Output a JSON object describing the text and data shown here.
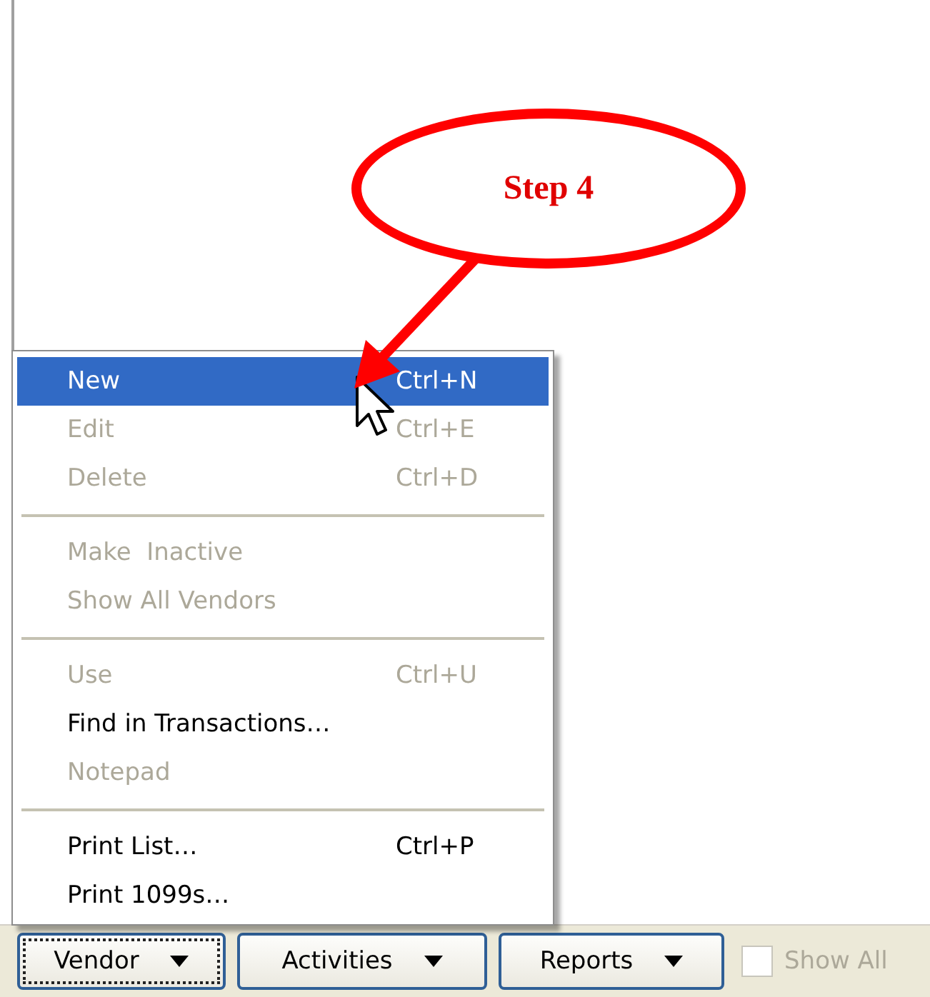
{
  "callout": {
    "text": "Step 4"
  },
  "menu": {
    "groups": [
      [
        {
          "label": "New",
          "shortcut": "Ctrl+N",
          "disabled": false,
          "selected": true
        },
        {
          "label": "Edit",
          "shortcut": "Ctrl+E",
          "disabled": true,
          "selected": false
        },
        {
          "label": "Delete",
          "shortcut": "Ctrl+D",
          "disabled": true,
          "selected": false
        }
      ],
      [
        {
          "label": "Make  Inactive",
          "disabled": true,
          "selected": false
        },
        {
          "label": "Show All Vendors",
          "disabled": true,
          "selected": false
        }
      ],
      [
        {
          "label": "Use",
          "shortcut": "Ctrl+U",
          "disabled": true,
          "selected": false
        },
        {
          "label": "Find in Transactions…",
          "disabled": false,
          "selected": false
        },
        {
          "label": "Notepad",
          "disabled": true,
          "selected": false
        }
      ],
      [
        {
          "label": "Print List…",
          "shortcut": "Ctrl+P",
          "disabled": false,
          "selected": false
        },
        {
          "label": "Print 1099s…",
          "disabled": false,
          "selected": false
        }
      ]
    ]
  },
  "toolbar": {
    "buttons": [
      {
        "label": "Vendor",
        "focused": true
      },
      {
        "label": "Activities",
        "focused": false
      },
      {
        "label": "Reports",
        "focused": false
      }
    ],
    "show_all": {
      "label": "Show All",
      "checked": false,
      "disabled": true
    }
  }
}
